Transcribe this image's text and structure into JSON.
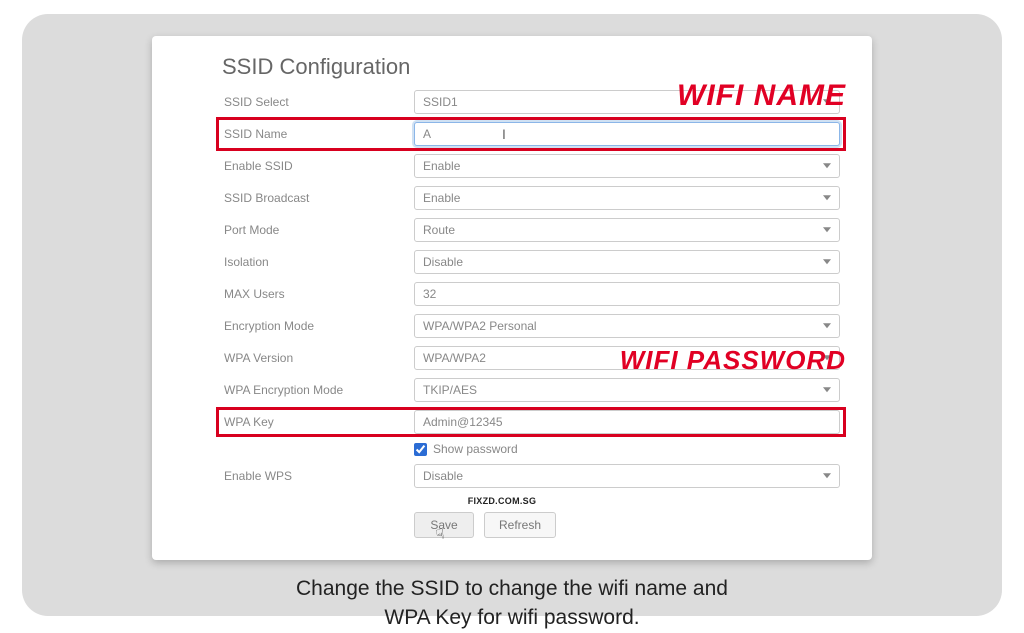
{
  "title": "SSID Configuration",
  "labels": {
    "ssid_select": "SSID Select",
    "ssid_name": "SSID Name",
    "enable_ssid": "Enable SSID",
    "ssid_broadcast": "SSID Broadcast",
    "port_mode": "Port Mode",
    "isolation": "Isolation",
    "max_users": "MAX Users",
    "encryption_mode": "Encryption Mode",
    "wpa_version": "WPA Version",
    "wpa_encryption_mode": "WPA Encryption Mode",
    "wpa_key": "WPA Key",
    "show_password": "Show password",
    "enable_wps": "Enable WPS"
  },
  "values": {
    "ssid_select": "SSID1",
    "ssid_name": "A",
    "enable_ssid": "Enable",
    "ssid_broadcast": "Enable",
    "port_mode": "Route",
    "isolation": "Disable",
    "max_users": "32",
    "encryption_mode": "WPA/WPA2 Personal",
    "wpa_version": "WPA/WPA2",
    "wpa_encryption_mode": "TKIP/AES",
    "wpa_key": "Admin@12345",
    "show_password_checked": true,
    "enable_wps": "Disable"
  },
  "annotations": {
    "wifi_name": "WIFI NAME",
    "wifi_password": "WIFI PASSWORD"
  },
  "watermark": "FIXZD.COM.SG",
  "buttons": {
    "save": "Save",
    "refresh": "Refresh"
  },
  "caption_line1": "Change the SSID to change the wifi name and",
  "caption_line2": "WPA Key for wifi password."
}
